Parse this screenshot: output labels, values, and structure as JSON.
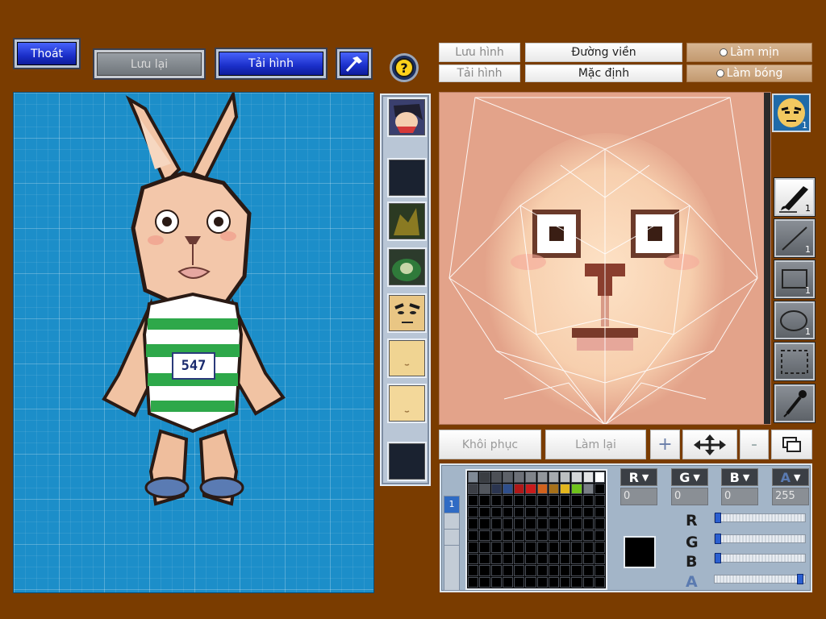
{
  "top_left": {
    "exit_label": "Thoát",
    "save_label": "Lưu lại",
    "load_label": "Tải hình"
  },
  "texture_toolbar": {
    "save_image": "Lưu hình",
    "outline": "Đường viền",
    "smooth": "Làm mịn",
    "load_image": "Tải hình",
    "default": "Mặc định",
    "shade": "Làm bóng"
  },
  "tools": [
    {
      "name": "brush",
      "count": "1"
    },
    {
      "name": "line",
      "count": "1"
    },
    {
      "name": "rectangle",
      "count": "1"
    },
    {
      "name": "ellipse",
      "count": "1"
    },
    {
      "name": "select",
      "count": ""
    },
    {
      "name": "eyedropper",
      "count": ""
    }
  ],
  "avatar_count": "1",
  "bottom_row": {
    "restore": "Khôi phục",
    "redo": "Làm lại"
  },
  "model": {
    "shirt_number": "547"
  },
  "palette": {
    "swatches": [
      "#808a96",
      "#3a3d42",
      "#4d5056",
      "#5d6168",
      "#6d7077",
      "#80848a",
      "#93979c",
      "#a7aaae",
      "#bcbfc2",
      "#d4d6d8",
      "#e3e4e5",
      "#ffffff",
      "#3c3f46",
      "#52565d",
      "#2b3550",
      "#2f4f8c",
      "#b01818",
      "#c81c1c",
      "#d0621e",
      "#a6701a",
      "#e3b61e",
      "#6fc21c",
      "#7a7f86"
    ],
    "current_color": "#000000"
  },
  "channels": {
    "r": {
      "label": "R",
      "value": "0"
    },
    "g": {
      "label": "G",
      "value": "0"
    },
    "b": {
      "label": "B",
      "value": "0"
    },
    "a": {
      "label": "A",
      "value": "255"
    }
  },
  "sliders": {
    "r_label": "R",
    "g_label": "G",
    "b_label": "B",
    "a_label": "A",
    "r": 0,
    "g": 0,
    "b": 0,
    "a": 255
  }
}
